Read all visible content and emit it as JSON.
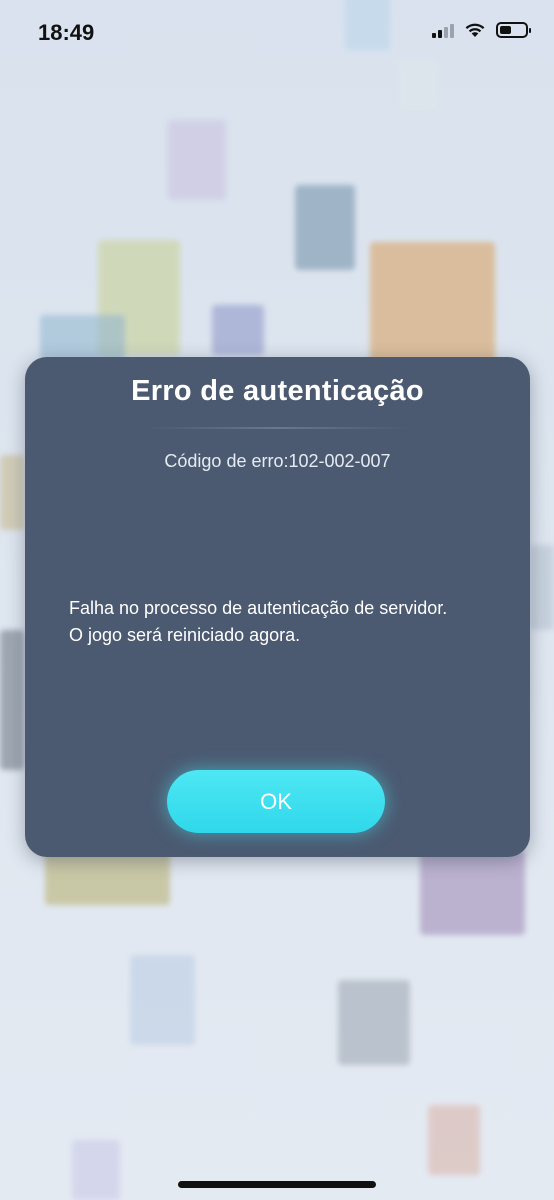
{
  "status_bar": {
    "time": "18:49",
    "icons": [
      "cellular-signal-icon",
      "wifi-icon",
      "battery-icon"
    ]
  },
  "dialog": {
    "title": "Erro de autenticação",
    "error_code": "Código de erro:102-002-007",
    "message_lines": [
      "Falha no processo de autenticação de servidor.",
      "O jogo será reiniciado agora."
    ],
    "ok_label": "OK"
  },
  "colors": {
    "dialog_bg": "#4b5a71",
    "button_accent": "#3fdeee",
    "background": "#dde5ef"
  }
}
